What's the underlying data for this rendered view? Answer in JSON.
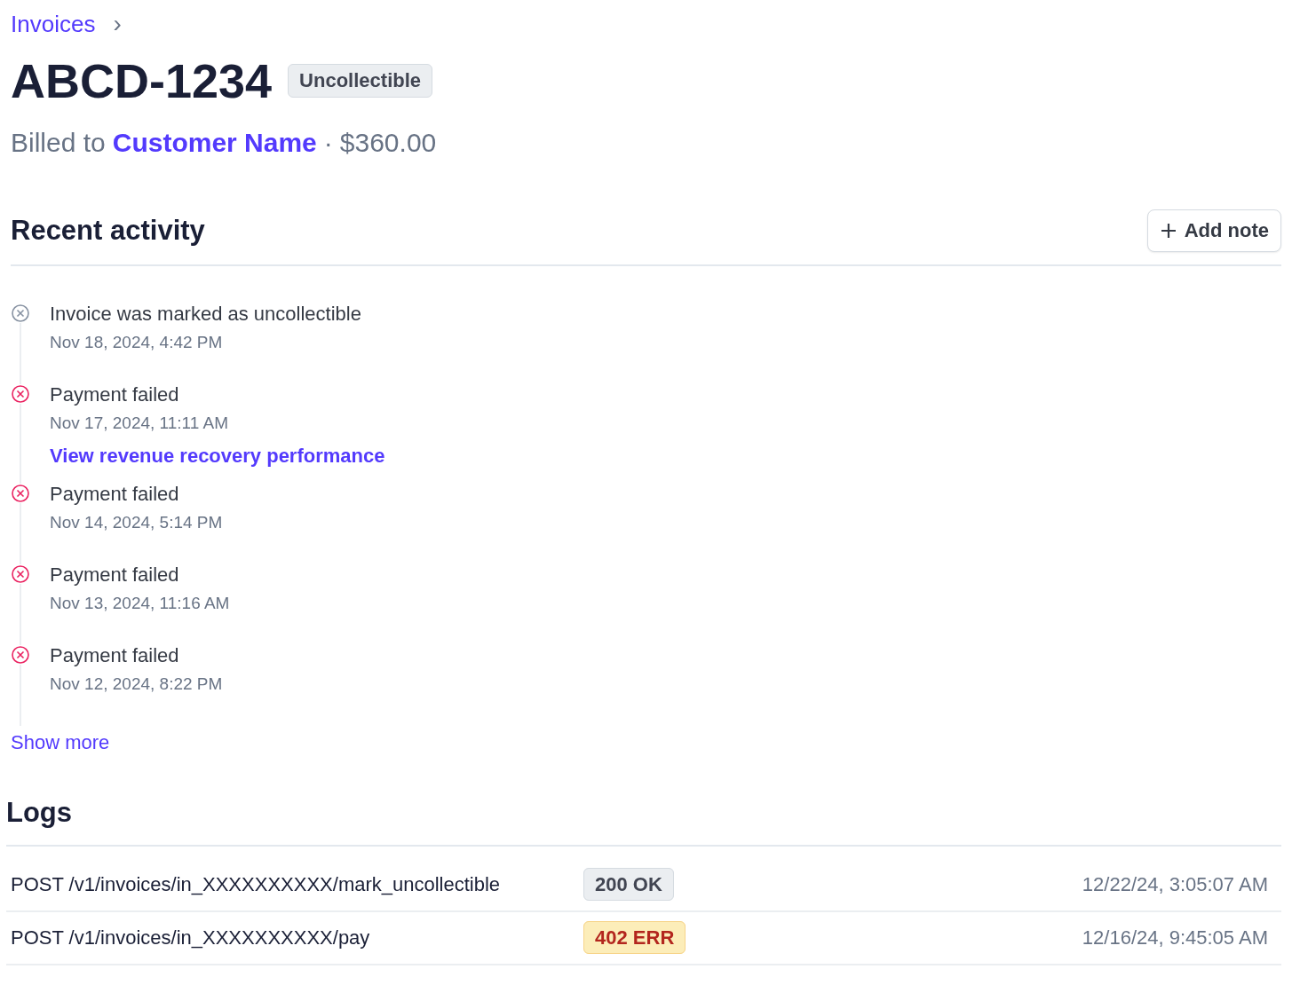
{
  "breadcrumb": {
    "label": "Invoices",
    "separator": "›"
  },
  "header": {
    "title": "ABCD-1234",
    "status": "Uncollectible",
    "billed_prefix": "Billed to",
    "customer": "Customer Name",
    "separator": "·",
    "amount": "$360.00"
  },
  "recent_activity": {
    "title": "Recent activity",
    "add_button": "Add note",
    "events": [
      {
        "kind": "neutral",
        "title": "Invoice was marked as uncollectible",
        "time": "Nov 18, 2024, 4:42 PM"
      },
      {
        "kind": "failed",
        "title": "Payment failed",
        "time": "Nov 17, 2024, 11:11 AM",
        "link": "View revenue recovery performance"
      },
      {
        "kind": "failed",
        "title": "Payment failed",
        "time": "Nov 14, 2024, 5:14 PM"
      },
      {
        "kind": "failed",
        "title": "Payment failed",
        "time": "Nov 13, 2024, 11:16 AM"
      },
      {
        "kind": "failed",
        "title": "Payment failed",
        "time": "Nov 12, 2024, 8:22 PM"
      }
    ],
    "show_more": "Show more"
  },
  "logs": {
    "title": "Logs",
    "rows": [
      {
        "request": "POST /v1/invoices/in_XXXXXXXXXX/mark_uncollectible",
        "status": "200 OK",
        "kind": "ok",
        "time": "12/22/24, 3:05:07 AM"
      },
      {
        "request": "POST /v1/invoices/in_XXXXXXXXXX/pay",
        "status": "402 ERR",
        "kind": "error",
        "time": "12/16/24, 9:45:05 AM"
      }
    ]
  }
}
